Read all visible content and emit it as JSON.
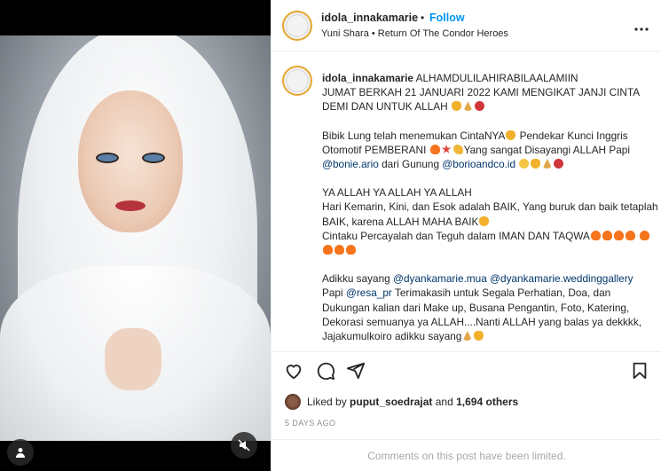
{
  "media": {
    "tag_icon": "user-tag-icon",
    "mute_icon": "speaker-muted-icon"
  },
  "header": {
    "username": "idola_innakamarie",
    "dot": "•",
    "follow_label": "Follow",
    "audio": "Yuni Shara • Return Of The Condor Heroes",
    "more_icon": "more-horizontal-icon"
  },
  "caption": {
    "username": "idola_innakamarie",
    "p1_l1": "ALHAMDULILAHIRABILAALAMIIN",
    "p1_l2": "JUMAT BERKAH 21 JANUARI 2022 KAMI MENGIKAT JANJI CINTA DEMI DAN UNTUK ALLAH",
    "p2_a": "Bibik Lung telah menemukan CintaNYA",
    "p2_b": " Pendekar Kunci Inggris Otomotif PEMBERANI",
    "p2_c": "Yang sangat Disayangi ALLAH Papi ",
    "p2_m1": "@bonie.ario",
    "p2_d": " dari Gunung ",
    "p2_m2": "@borioandco.id",
    "p3_l1": "YA ALLAH YA ALLAH YA ALLAH",
    "p3_l2": "Hari Kemarin, Kini, dan Esok adalah BAIK, Yang buruk dan baik tetaplah BAIK, karena ALLAH MAHA BAIK",
    "p3_l3": "Cintaku Percayalah dan Teguh dalam IMAN DAN TAQWA",
    "p4_a": "Adikku sayang ",
    "p4_m1": "@dyankamarie.mua",
    "p4_m2": "@dyankamarie.weddinggallery",
    "p4_b": "Papi ",
    "p4_m3": "@resa_pr",
    "p4_c": " Terimakasih untuk Segala Perhatian, Doa, dan Dukungan kalian dari Make up, Busana Pengantin, Foto, Katering, Dekorasi semuanya ya ALLAH....Nanti ALLAH yang balas ya dekkkk, Jajakumulkoiro adikku sayang"
  },
  "actions": {
    "like_icon": "heart-icon",
    "comment_icon": "comment-icon",
    "share_icon": "share-icon",
    "save_icon": "bookmark-icon"
  },
  "likes": {
    "prefix": "Liked by ",
    "user": "puput_soedrajat",
    "and": " and ",
    "count": "1,694 others"
  },
  "time_ago": "5 DAYS AGO",
  "comments_limited": "Comments on this post have been limited.",
  "colors": {
    "accent": "#0095f6",
    "mention": "#00376b",
    "muted": "#8e8e8e"
  }
}
